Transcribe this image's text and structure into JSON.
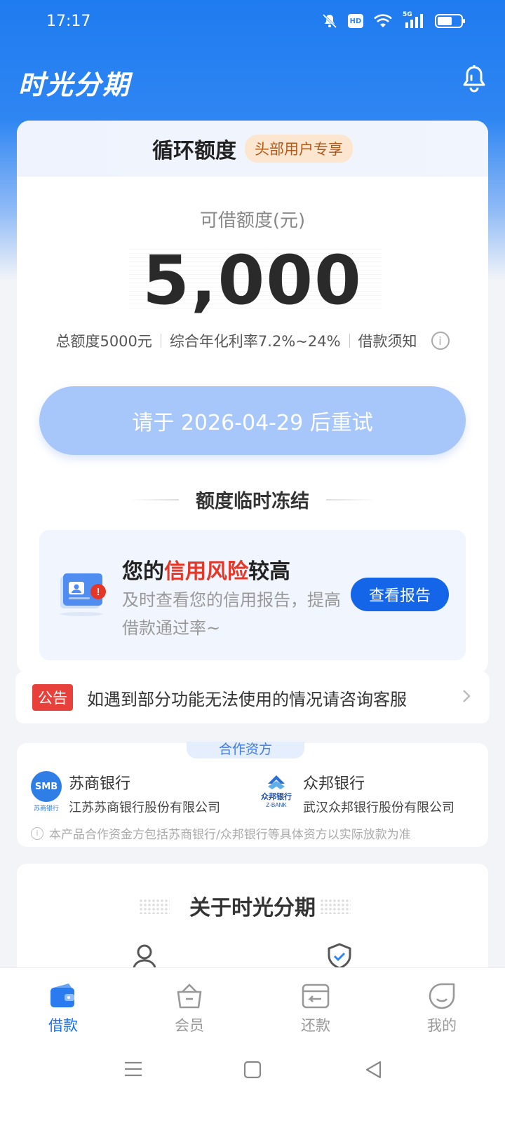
{
  "status_bar": {
    "time": "17:17",
    "icons": [
      "mute-icon",
      "hd-icon",
      "wifi-icon",
      "5g-signal-icon",
      "battery-icon"
    ],
    "hd_text": "HD",
    "network_text": "5G"
  },
  "header": {
    "title": "时光分期",
    "bell_icon": "bell-icon"
  },
  "credit_card": {
    "title": "循环额度",
    "badge": "头部用户专享",
    "amount_label": "可借额度(元)",
    "amount": "5,000",
    "total_quota": "总额度5000元",
    "interest_rate": "综合年化利率7.2%~24%",
    "loan_notice": "借款须知",
    "retry_button": "请于 2026-04-29 后重试",
    "freeze_title": "额度临时冻结",
    "risk": {
      "title_prefix": "您的",
      "title_highlight": "信用风险",
      "title_suffix": "较高",
      "description": "及时查看您的信用报告，提高借款通过率~",
      "button": "查看报告"
    }
  },
  "notice": {
    "badge": "公告",
    "text": "如遇到部分功能无法使用的情况请咨询客服"
  },
  "partners": {
    "tag": "合作资方",
    "items": [
      {
        "name": "苏商银行",
        "company": "江苏苏商银行股份有限公司",
        "logo_text": "SMB",
        "logo_sub": "苏商银行"
      },
      {
        "name": "众邦银行",
        "company": "武汉众邦银行股份有限公司",
        "logo_text": "众邦银行",
        "logo_sub": "Z-BANK"
      }
    ],
    "note": "本产品合作资金方包括苏商银行/众邦银行等具体资方以实际放款为准"
  },
  "about": {
    "title": "关于时光分期"
  },
  "tabbar": {
    "items": [
      {
        "label": "借款",
        "icon": "wallet-icon",
        "active": true
      },
      {
        "label": "会员",
        "icon": "crown-basket-icon",
        "active": false
      },
      {
        "label": "还款",
        "icon": "card-return-icon",
        "active": false
      },
      {
        "label": "我的",
        "icon": "smile-face-icon",
        "active": false
      }
    ]
  },
  "colors": {
    "primary": "#1a6ee8",
    "header_blue": "#1f7bf0",
    "risk_red": "#e53628",
    "retry_button": "#a7c7fb",
    "notice_badge": "#e8403a"
  }
}
